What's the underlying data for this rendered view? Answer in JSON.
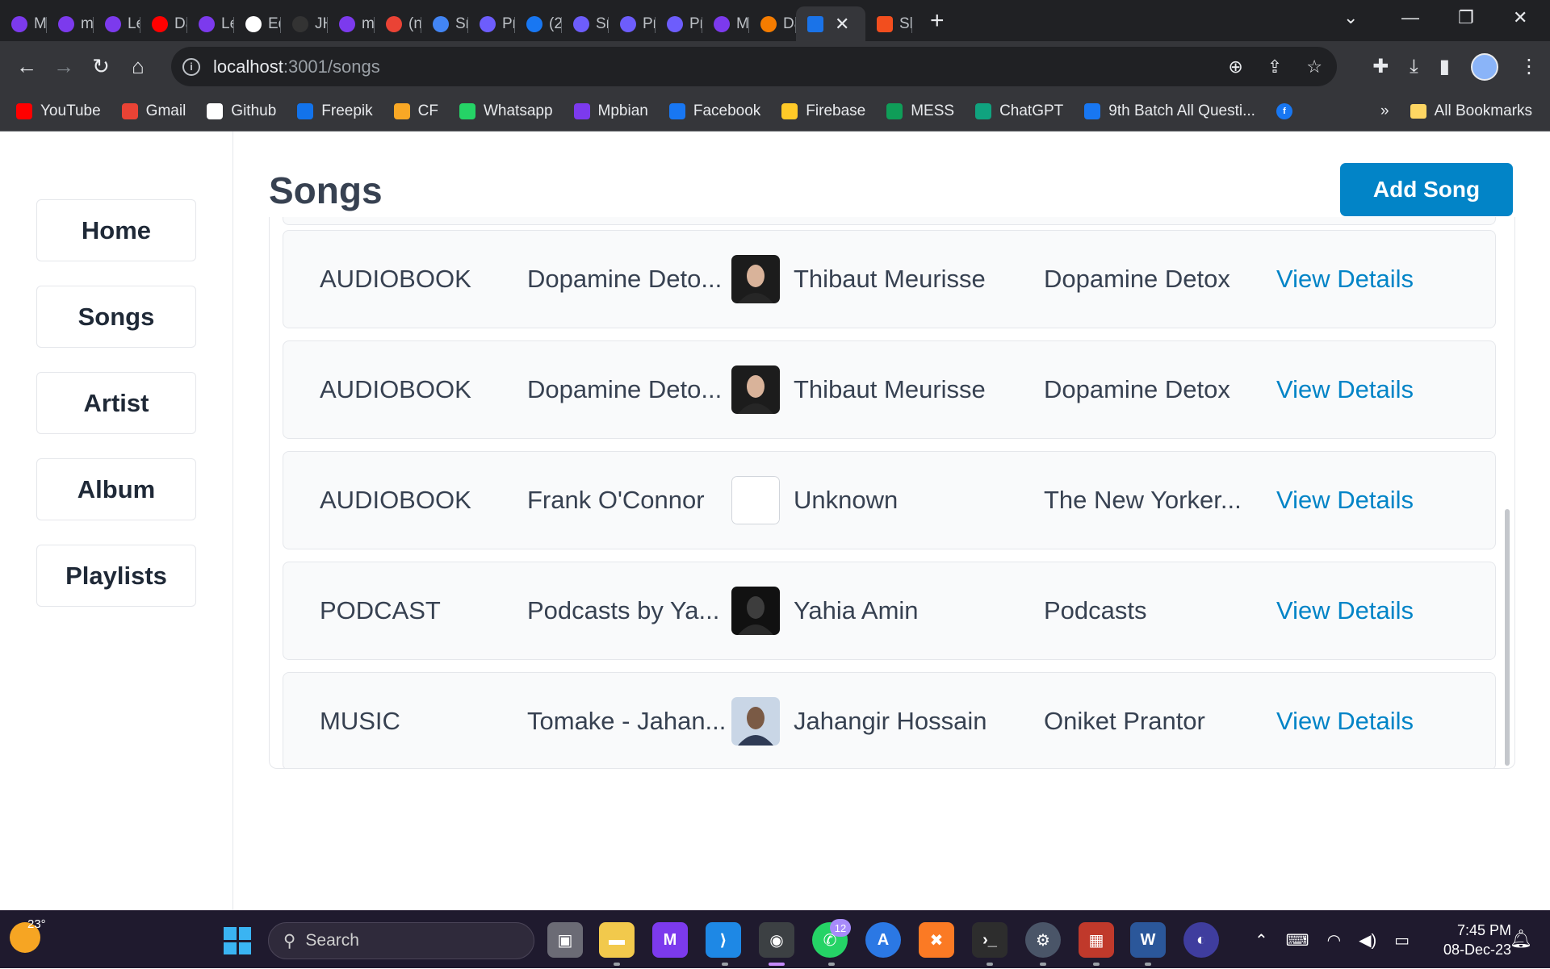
{
  "browser": {
    "tabs": [
      {
        "label": "M",
        "color": "#7c3aed"
      },
      {
        "label": "m",
        "color": "#7c3aed"
      },
      {
        "label": "Le",
        "color": "#7c3aed"
      },
      {
        "label": "Da",
        "color": "#ff0000"
      },
      {
        "label": "Le",
        "color": "#7c3aed"
      },
      {
        "label": "Ed",
        "color": "#ffffff"
      },
      {
        "label": "JH",
        "color": "#333333"
      },
      {
        "label": "m",
        "color": "#7c3aed"
      },
      {
        "label": "(n",
        "color": "#ea4335"
      },
      {
        "label": "Sn",
        "color": "#4285f4"
      },
      {
        "label": "Pri",
        "color": "#6d5dfc"
      },
      {
        "label": "(2)",
        "color": "#1877f2"
      },
      {
        "label": "Sn",
        "color": "#6d5dfc"
      },
      {
        "label": "Pri",
        "color": "#6d5dfc"
      },
      {
        "label": "Pri",
        "color": "#6d5dfc"
      },
      {
        "label": "M",
        "color": "#7c3aed"
      },
      {
        "label": "Da",
        "color": "#f57c00"
      }
    ],
    "active_tab_color": "#1a73e8",
    "after_tab": {
      "label": "Sh",
      "color": "#f24e1e"
    },
    "url_host": "localhost",
    "url_path": ":3001/songs",
    "bookmarks": [
      {
        "label": "YouTube",
        "icon": "youtube-icon",
        "color": "#ff0000"
      },
      {
        "label": "Gmail",
        "icon": "gmail-icon",
        "color": "#ea4335"
      },
      {
        "label": "Github",
        "icon": "github-icon",
        "color": "#ffffff"
      },
      {
        "label": "Freepik",
        "icon": "freepik-icon",
        "color": "#1273eb"
      },
      {
        "label": "CF",
        "icon": "codeforces-icon",
        "color": "#f9a825"
      },
      {
        "label": "Whatsapp",
        "icon": "whatsapp-icon",
        "color": "#25d366"
      },
      {
        "label": "Mpbian",
        "icon": "mpbian-icon",
        "color": "#7c3aed"
      },
      {
        "label": "Facebook",
        "icon": "facebook-icon",
        "color": "#1877f2"
      },
      {
        "label": "Firebase",
        "icon": "firebase-icon",
        "color": "#ffca28"
      },
      {
        "label": "MESS",
        "icon": "sheets-icon",
        "color": "#0f9d58"
      },
      {
        "label": "ChatGPT",
        "icon": "chatgpt-icon",
        "color": "#10a37f"
      },
      {
        "label": "9th Batch All Questi...",
        "icon": "facebook-icon",
        "color": "#1877f2"
      }
    ],
    "bookmarks_overflow": "»",
    "all_bookmarks": "All Bookmarks"
  },
  "sidebar": {
    "items": [
      {
        "label": "Home"
      },
      {
        "label": "Songs"
      },
      {
        "label": "Artist"
      },
      {
        "label": "Album"
      },
      {
        "label": "Playlists"
      }
    ]
  },
  "main": {
    "title": "Songs",
    "add_button": "Add Song",
    "rows": [
      {
        "type": "AUDIOBOOK",
        "title": "Dopamine Deto...",
        "artist": "Thibaut Meurisse",
        "album": "Dopamine Detox",
        "link": "View Details",
        "thumb": "portrait-man"
      },
      {
        "type": "AUDIOBOOK",
        "title": "Dopamine Deto...",
        "artist": "Thibaut Meurisse",
        "album": "Dopamine Detox",
        "link": "View Details",
        "thumb": "portrait-man"
      },
      {
        "type": "AUDIOBOOK",
        "title": "Frank O'Connor",
        "artist": "Unknown",
        "album": "The New Yorker...",
        "link": "View Details",
        "thumb": "blank"
      },
      {
        "type": "PODCAST",
        "title": "Podcasts by Ya...",
        "artist": "Yahia Amin",
        "album": "Podcasts",
        "link": "View Details",
        "thumb": "portrait-dark"
      },
      {
        "type": "MUSIC",
        "title": "Tomake - Jahan...",
        "artist": "Jahangir Hossain",
        "album": "Oniket Prantor",
        "link": "View Details",
        "thumb": "portrait-light"
      }
    ]
  },
  "taskbar": {
    "weather_temp": "23°",
    "search_placeholder": "Search",
    "whatsapp_badge": "12",
    "time": "7:45 PM",
    "date": "08-Dec-23"
  },
  "colors": {
    "accent": "#0284c7",
    "row_bg": "#f9fafb",
    "border": "#e5e7eb"
  }
}
